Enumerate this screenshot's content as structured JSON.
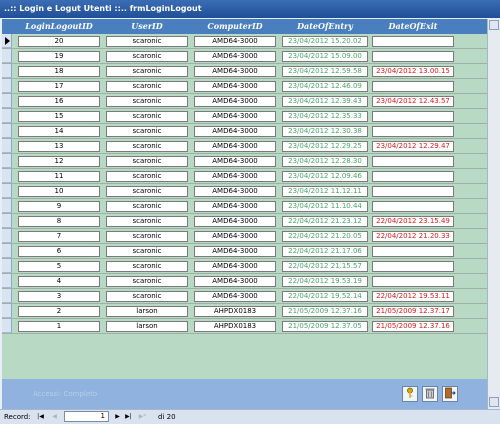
{
  "window": {
    "title": "..:: Login e Logut Utenti ::..  frmLoginLogout"
  },
  "columns": {
    "id": "LoginLogoutID",
    "user": "UserID",
    "computer": "ComputerID",
    "entry": "DateOfEntry",
    "exit": "DateOfExit"
  },
  "rows": [
    {
      "id": "20",
      "user": "scaronic",
      "computer": "AMD64-3000",
      "entry": "23/04/2012 15.20.02",
      "exit": ""
    },
    {
      "id": "19",
      "user": "scaronic",
      "computer": "AMD64-3000",
      "entry": "23/04/2012 15.09.00",
      "exit": ""
    },
    {
      "id": "18",
      "user": "scaronic",
      "computer": "AMD64-3000",
      "entry": "23/04/2012 12.59.58",
      "exit": "23/04/2012 13.00.15"
    },
    {
      "id": "17",
      "user": "scaronic",
      "computer": "AMD64-3000",
      "entry": "23/04/2012 12.46.09",
      "exit": ""
    },
    {
      "id": "16",
      "user": "scaronic",
      "computer": "AMD64-3000",
      "entry": "23/04/2012 12.39.43",
      "exit": "23/04/2012 12.43.57"
    },
    {
      "id": "15",
      "user": "scaronic",
      "computer": "AMD64-3000",
      "entry": "23/04/2012 12.35.33",
      "exit": ""
    },
    {
      "id": "14",
      "user": "scaronic",
      "computer": "AMD64-3000",
      "entry": "23/04/2012 12.30.38",
      "exit": ""
    },
    {
      "id": "13",
      "user": "scaronic",
      "computer": "AMD64-3000",
      "entry": "23/04/2012 12.29.25",
      "exit": "23/04/2012 12.29.47"
    },
    {
      "id": "12",
      "user": "scaronic",
      "computer": "AMD64-3000",
      "entry": "23/04/2012 12.28.30",
      "exit": ""
    },
    {
      "id": "11",
      "user": "scaronic",
      "computer": "AMD64-3000",
      "entry": "23/04/2012 12.09.46",
      "exit": ""
    },
    {
      "id": "10",
      "user": "scaronic",
      "computer": "AMD64-3000",
      "entry": "23/04/2012 11.12.11",
      "exit": ""
    },
    {
      "id": "9",
      "user": "scaronic",
      "computer": "AMD64-3000",
      "entry": "23/04/2012 11.10.44",
      "exit": ""
    },
    {
      "id": "8",
      "user": "scaronic",
      "computer": "AMD64-3000",
      "entry": "22/04/2012 21.23.12",
      "exit": "22/04/2012 23.15.49"
    },
    {
      "id": "7",
      "user": "scaronic",
      "computer": "AMD64-3000",
      "entry": "22/04/2012 21.20.05",
      "exit": "22/04/2012 21.20.33"
    },
    {
      "id": "6",
      "user": "scaronic",
      "computer": "AMD64-3000",
      "entry": "22/04/2012 21.17.06",
      "exit": ""
    },
    {
      "id": "5",
      "user": "scaronic",
      "computer": "AMD64-3000",
      "entry": "22/04/2012 21.15.57",
      "exit": ""
    },
    {
      "id": "4",
      "user": "scaronic",
      "computer": "AMD64-3000",
      "entry": "22/04/2012 19.53.19",
      "exit": ""
    },
    {
      "id": "3",
      "user": "scaronic",
      "computer": "AMD64-3000",
      "entry": "22/04/2012 19.52.14",
      "exit": "22/04/2012 19.53.11"
    },
    {
      "id": "2",
      "user": "larson",
      "computer": "AHPDX0183",
      "entry": "21/05/2009 12.37.16",
      "exit": "21/05/2009 12.37.17"
    },
    {
      "id": "1",
      "user": "larson",
      "computer": "AHPDX0183",
      "entry": "21/05/2009 12.37.05",
      "exit": "21/05/2009 12.37.16"
    }
  ],
  "footer": {
    "accessi_label": "Accessi: Completo",
    "help_icon": "key-icon",
    "delete_icon": "trash-icon",
    "exit_icon": "door-exit-icon"
  },
  "navigation": {
    "label": "Record:",
    "current": "1",
    "total": "di 20"
  },
  "colors": {
    "header": "#4a7fbf",
    "detail": "#b8d9c3",
    "footer": "#8fb3de",
    "entry_text": "#4aa567",
    "exit_text": "#e01818"
  }
}
